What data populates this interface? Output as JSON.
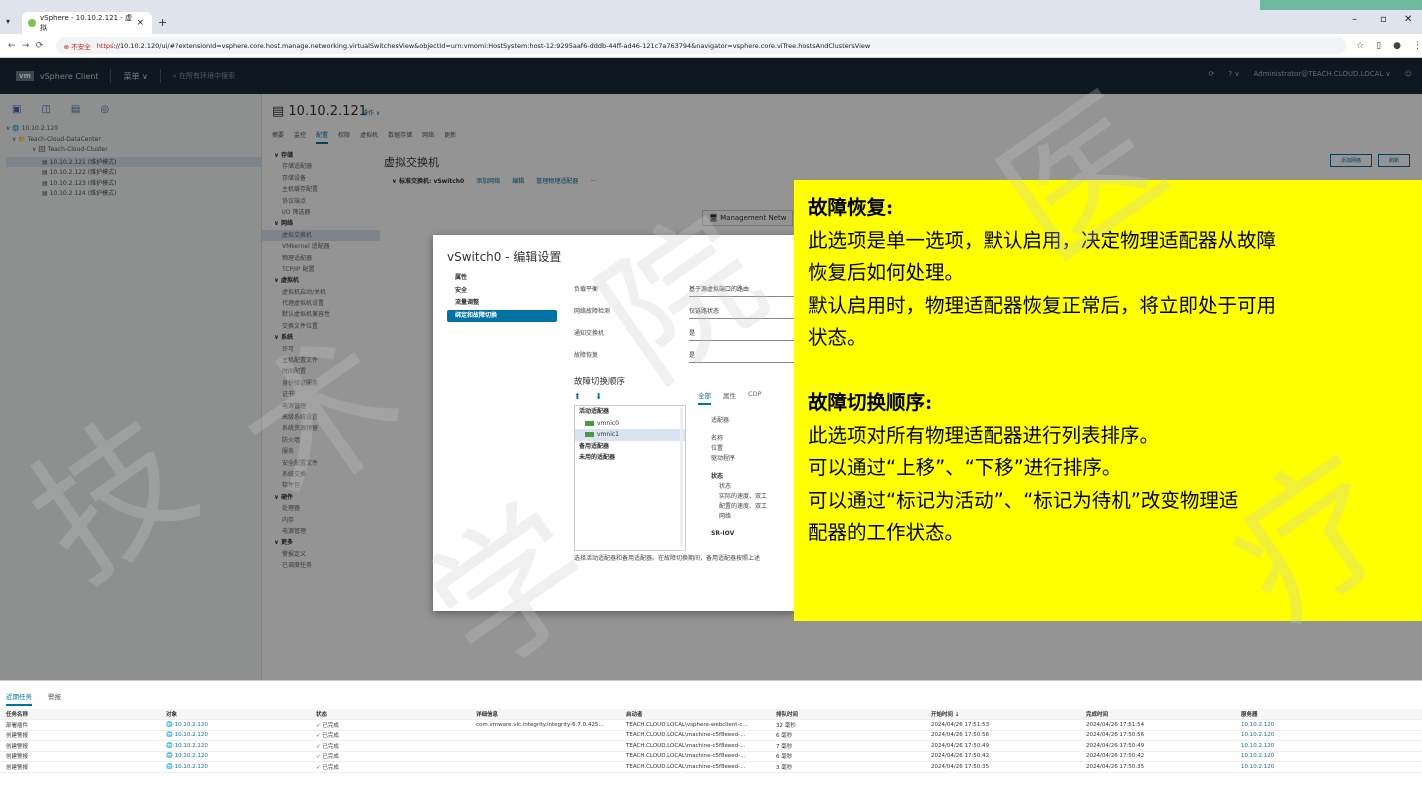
{
  "browser": {
    "tab_title": "vSphere - 10.10.2.121 - 虚拟",
    "url_warning": "不安全",
    "url_scheme": "https",
    "url_rest": "://10.10.2.120/ui/#?extensionId=vsphere.core.host.manage.networking.virtualSwitchesView&objectId=urn:vmomi:HostSystem:host-12:9295aaf6-dddb-44ff-ad46-121c7a763794&navigator=vsphere.core.viTree.hostsAndClustersView"
  },
  "vsphere_header": {
    "logo": "vm",
    "app": "vSphere Client",
    "menu": "菜单 ∨",
    "search": "在所有环境中搜索",
    "user": "Administrator@TEACH.CLOUD.LOCAL ∨"
  },
  "tree": [
    "∨ 🌐 10.10.2.120",
    "∨ 📁 Teach-Cloud-DataCenter",
    "∨ 🗄 Teach-Cloud-Cluster",
    "▤ 10.10.2.121 (维护模式)",
    "▤ 10.10.2.122 (维护模式)",
    "▤ 10.10.2.123 (维护模式)",
    "▤ 10.10.2.124 (维护模式)"
  ],
  "content": {
    "host": "▤ 10.10.2.121",
    "actions": "操作 ∨",
    "tabs": [
      "摘要",
      "监控",
      "配置",
      "权限",
      "虚拟机",
      "数据存储",
      "网络",
      "更新"
    ],
    "active_tab": "配置",
    "page_title": "虚拟交换机",
    "switch_row": "∨ 标准交换机: vSwitch0",
    "switch_links": [
      "添加网络",
      "编辑",
      "管理物理适配器"
    ],
    "top_buttons": [
      "添加网络",
      "刷新"
    ],
    "mgmt": "🖥 Management Netw"
  },
  "settings_nav": [
    {
      "t": "∨ 存储",
      "g": true
    },
    {
      "t": "存储适配器"
    },
    {
      "t": "存储设备"
    },
    {
      "t": "主机缓存配置"
    },
    {
      "t": "协议端点"
    },
    {
      "t": "I/O 筛选器"
    },
    {
      "t": "∨ 网络",
      "g": true
    },
    {
      "t": "虚拟交换机",
      "sel": true
    },
    {
      "t": "VMkernel 适配器"
    },
    {
      "t": "物理适配器"
    },
    {
      "t": "TCP/IP 配置"
    },
    {
      "t": "∨ 虚拟机",
      "g": true
    },
    {
      "t": "虚拟机启动/关机"
    },
    {
      "t": "代理虚拟机设置"
    },
    {
      "t": "默认虚拟机兼容性"
    },
    {
      "t": "交换文件位置"
    },
    {
      "t": "∨ 系统",
      "g": true
    },
    {
      "t": "许可"
    },
    {
      "t": "主机配置文件"
    },
    {
      "t": "时间配置"
    },
    {
      "t": "身份验证服务"
    },
    {
      "t": "证书"
    },
    {
      "t": "电源管理"
    },
    {
      "t": "高级系统设置"
    },
    {
      "t": "系统资源预留"
    },
    {
      "t": "防火墙"
    },
    {
      "t": "服务"
    },
    {
      "t": "安全配置文件"
    },
    {
      "t": "系统交换"
    },
    {
      "t": "软件包"
    },
    {
      "t": "∨ 硬件",
      "g": true
    },
    {
      "t": "处理器"
    },
    {
      "t": "内存"
    },
    {
      "t": "电源管理"
    },
    {
      "t": "∨ 更多",
      "g": true
    },
    {
      "t": "警报定义"
    },
    {
      "t": "已调度任务"
    }
  ],
  "dialog": {
    "title": "vSwitch0 - 编辑设置",
    "nav": [
      "属性",
      "安全",
      "流量调整",
      "绑定和故障切换"
    ],
    "fields": [
      {
        "label": "负载平衡",
        "value": "基于源虚拟端口的路由"
      },
      {
        "label": "网络故障检测",
        "value": "仅链路状态"
      },
      {
        "label": "通知交换机",
        "value": "是"
      },
      {
        "label": "故障恢复",
        "value": "是"
      }
    ],
    "failover_title": "故障切换顺序",
    "arrows": "⬆ ⬇",
    "list": [
      {
        "t": "活动适配器",
        "kind": "bold"
      },
      {
        "t": "vmnic0",
        "kind": "nic"
      },
      {
        "t": "vmnic1",
        "kind": "nic sel"
      },
      {
        "t": "备用适配器",
        "kind": "bold"
      },
      {
        "t": "未用的适配器",
        "kind": "bold"
      }
    ],
    "detail_tabs": [
      "全部",
      "属性",
      "CDP"
    ],
    "detail": {
      "adapter": "适配器",
      "name": "名称",
      "location": "位置",
      "driver": "驱动程序",
      "status_h": "状态",
      "status": "状态",
      "actual_speed": "实际的速度、双工",
      "config_speed": "配置的速度、双工",
      "network": "网络",
      "sriov": "SR-IOV"
    },
    "help": "选择活动适配器和备用适配器。在故障切换期间，备用适配器按照上述"
  },
  "tasks": {
    "tabs": [
      "近期任务",
      "警报"
    ],
    "headers": [
      "任务名称",
      "对象",
      "状态",
      "详细信息",
      "启动者",
      "排队时间",
      "开始时间 ↓",
      "完成时间",
      "服务器"
    ],
    "rows": [
      [
        "部署插件",
        "10.10.2.120",
        "已完成",
        "com.vmware.vlc.integrity.integrity-6.7.0.425...",
        "TEACH.CLOUD.LOCAL\\vsphere-webclient-c...",
        "32 毫秒",
        "2024/04/26 17:51:53",
        "2024/04/26 17:51:54",
        "10.10.2.120"
      ],
      [
        "创建警报",
        "10.10.2.120",
        "已完成",
        "",
        "TEACH.CLOUD.LOCAL\\machine-c5f8eeed-...",
        "6 毫秒",
        "2024/04/26 17:50:56",
        "2024/04/26 17:50:56",
        "10.10.2.120"
      ],
      [
        "创建警报",
        "10.10.2.120",
        "已完成",
        "",
        "TEACH.CLOUD.LOCAL\\machine-c5f8eeed-...",
        "7 毫秒",
        "2024/04/26 17:50:49",
        "2024/04/26 17:50:49",
        "10.10.2.120"
      ],
      [
        "创建警报",
        "10.10.2.120",
        "已完成",
        "",
        "TEACH.CLOUD.LOCAL\\machine-c5f8eeed-...",
        "6 毫秒",
        "2024/04/26 17:50:42",
        "2024/04/26 17:50:42",
        "10.10.2.120"
      ],
      [
        "创建警报",
        "10.10.2.120",
        "已完成",
        "",
        "TEACH.CLOUD.LOCAL\\machine-c5f8eeed-...",
        "3 毫秒",
        "2024/04/26 17:50:35",
        "2024/04/26 17:50:35",
        "10.10.2.120"
      ]
    ]
  },
  "note": {
    "heading1": "故障恢复:",
    "lines1": [
      "此选项是单一选项，默认启用，决定物理适配器从故障",
      "恢复后如何处理。",
      "默认启用时，物理适配器恢复正常后，将立即处于可用",
      "状态。"
    ],
    "heading2": "故障切换顺序:",
    "lines2": [
      "此选项对所有物理适配器进行列表排序。",
      "可以通过“上移”、“下移”进行排序。",
      "可以通过“标记为活动”、“标记为待机”改变物理适",
      "配器的工作状态。"
    ]
  },
  "watermark": [
    "技",
    "术",
    "学",
    "院",
    "医",
    "疗"
  ],
  "colors": {
    "accent": "#0072a3",
    "note_bg": "#ffff00",
    "header_bg": "#1b2a38"
  }
}
